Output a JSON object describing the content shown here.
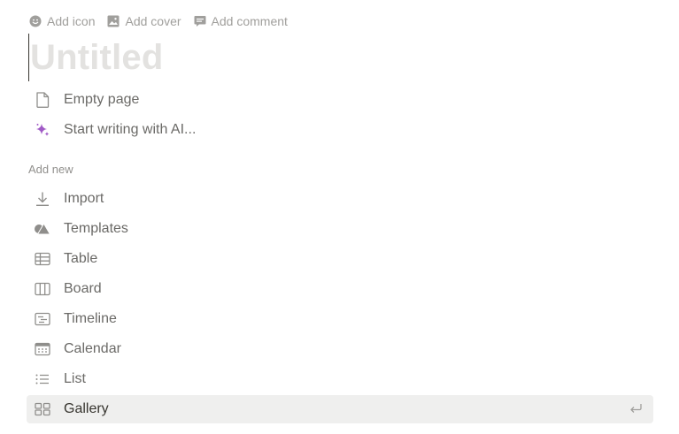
{
  "page_controls": {
    "add_icon": "Add icon",
    "add_cover": "Add cover",
    "add_comment": "Add comment"
  },
  "title": {
    "placeholder": "Untitled"
  },
  "starters": [
    {
      "label": "Empty page",
      "icon": "page-icon"
    },
    {
      "label": "Start writing with AI...",
      "icon": "ai-sparkle-icon"
    }
  ],
  "add_new": {
    "heading": "Add new",
    "items": [
      {
        "label": "Import",
        "icon": "import-icon"
      },
      {
        "label": "Templates",
        "icon": "templates-icon"
      },
      {
        "label": "Table",
        "icon": "table-icon"
      },
      {
        "label": "Board",
        "icon": "board-icon"
      },
      {
        "label": "Timeline",
        "icon": "timeline-icon"
      },
      {
        "label": "Calendar",
        "icon": "calendar-icon"
      },
      {
        "label": "List",
        "icon": "list-icon"
      },
      {
        "label": "Gallery",
        "icon": "gallery-icon",
        "selected": true
      }
    ]
  },
  "colors": {
    "text": "#37352f",
    "muted": "#a09f9c",
    "placeholder": "#e3e2e0",
    "ai_accent": "#a05ac6",
    "hover_bg": "#efefee"
  }
}
